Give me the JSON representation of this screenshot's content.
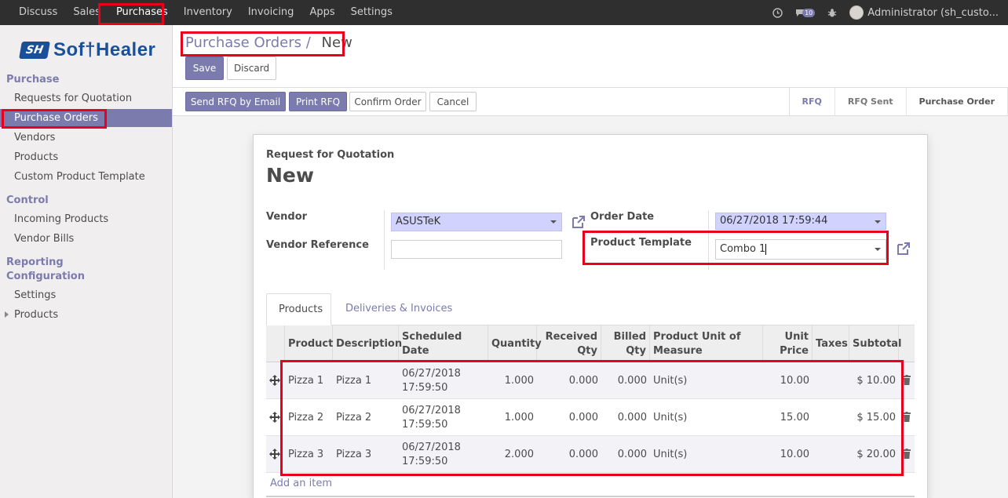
{
  "topbar": {
    "menu": [
      "Discuss",
      "Sales",
      "Purchases",
      "Inventory",
      "Invoicing",
      "Apps",
      "Settings"
    ],
    "active": "Purchases",
    "messages_count": "10",
    "user": "Administrator (sh_custo..."
  },
  "sidebar": {
    "logo_text": "Sof†Healer",
    "logo_mark": "SH",
    "sections": {
      "purchase": "Purchase",
      "control": "Control",
      "reporting": "Reporting",
      "configuration": "Configuration"
    },
    "items": {
      "rfq": "Requests for Quotation",
      "purchase_orders": "Purchase Orders",
      "vendors": "Vendors",
      "products": "Products",
      "custom_template": "Custom Product Template",
      "incoming": "Incoming Products",
      "vendor_bills": "Vendor Bills",
      "settings": "Settings",
      "config_products": "Products"
    }
  },
  "control": {
    "breadcrumb_parent": "Purchase Orders",
    "breadcrumb_sep": "/",
    "breadcrumb_current": "New",
    "save": "Save",
    "discard": "Discard"
  },
  "statusbar": {
    "send_rfq": "Send RFQ by Email",
    "print_rfq": "Print RFQ",
    "confirm": "Confirm Order",
    "cancel": "Cancel",
    "stages": [
      "RFQ",
      "RFQ Sent",
      "Purchase Order"
    ],
    "current_stage": "RFQ"
  },
  "form": {
    "subtitle": "Request for Quotation",
    "title": "New",
    "vendor_label": "Vendor",
    "vendor_value": "ASUSTeK",
    "vendor_ref_label": "Vendor Reference",
    "vendor_ref_value": "",
    "order_date_label": "Order Date",
    "order_date_value": "06/27/2018 17:59:44",
    "product_template_label": "Product Template",
    "product_template_value": "Combo 1"
  },
  "tabs": {
    "products": "Products",
    "deliveries": "Deliveries & Invoices"
  },
  "table": {
    "headers": {
      "product": "Product",
      "description": "Description",
      "scheduled_date": "Scheduled Date",
      "quantity": "Quantity",
      "received_1": "Received",
      "received_2": "Qty",
      "billed_1": "Billed",
      "billed_2": "Qty",
      "uom_1": "Product Unit of",
      "uom_2": "Measure",
      "unit_price_1": "Unit",
      "unit_price_2": "Price",
      "taxes": "Taxes",
      "subtotal": "Subtotal"
    },
    "rows": [
      {
        "product": "Pizza 1",
        "description": "Pizza 1",
        "date_1": "06/27/2018",
        "date_2": "17:59:50",
        "quantity": "1.000",
        "received": "0.000",
        "billed": "0.000",
        "uom": "Unit(s)",
        "unit_price": "10.00",
        "taxes": "",
        "subtotal": "$ 10.00"
      },
      {
        "product": "Pizza 2",
        "description": "Pizza 2",
        "date_1": "06/27/2018",
        "date_2": "17:59:50",
        "quantity": "1.000",
        "received": "0.000",
        "billed": "0.000",
        "uom": "Unit(s)",
        "unit_price": "15.00",
        "taxes": "",
        "subtotal": "$ 15.00"
      },
      {
        "product": "Pizza 3",
        "description": "Pizza 3",
        "date_1": "06/27/2018",
        "date_2": "17:59:50",
        "quantity": "2.000",
        "received": "0.000",
        "billed": "0.000",
        "uom": "Unit(s)",
        "unit_price": "10.00",
        "taxes": "",
        "subtotal": "$ 20.00"
      }
    ],
    "add_item": "Add an item"
  },
  "colors": {
    "accent": "#7c7bad",
    "highlight": "#e8001c",
    "topbar": "#2f2f2f"
  }
}
